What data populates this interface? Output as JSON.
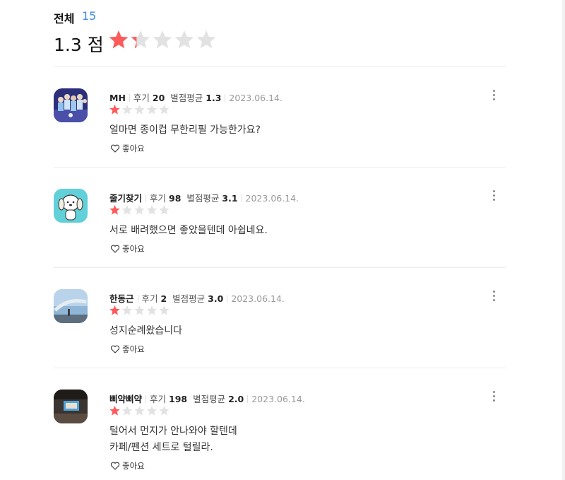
{
  "summary": {
    "all_label": "전체",
    "all_count": "15",
    "score_text": "1.3 점",
    "rating": 1.3,
    "max_rating": 5
  },
  "colors": {
    "star_on": "#ff5a5a",
    "star_off": "#e2e2e2",
    "count_blue": "#3d8be0"
  },
  "reviews": [
    {
      "nickname": "MH",
      "review_label": "후기",
      "review_count": "20",
      "avg_label": "별점평균",
      "avg_value": "1.3",
      "date": "2023.06.14.",
      "rating": 1,
      "text_lines": [
        "얼마면 종이컵 무한리필 가능한가요?"
      ],
      "like_label": "좋아요",
      "avatar": "soccer-team-avatar"
    },
    {
      "nickname": "줄기찾기",
      "review_label": "후기",
      "review_count": "98",
      "avg_label": "별점평균",
      "avg_value": "3.1",
      "date": "2023.06.14.",
      "rating": 1,
      "text_lines": [
        "서로 배려했으면 좋았을텐데 아쉽네요."
      ],
      "like_label": "좋아요",
      "avatar": "puppy-character-avatar"
    },
    {
      "nickname": "한동근",
      "review_label": "후기",
      "review_count": "2",
      "avg_label": "별점평균",
      "avg_value": "3.0",
      "date": "2023.06.14.",
      "rating": 1,
      "text_lines": [
        "성지순례왔습니다"
      ],
      "like_label": "좋아요",
      "avatar": "sky-landscape-avatar"
    },
    {
      "nickname": "삐약삐약",
      "review_label": "후기",
      "review_count": "198",
      "avg_label": "별점평균",
      "avg_value": "2.0",
      "date": "2023.06.14.",
      "rating": 1,
      "text_lines": [
        "털어서 먼지가 안나와야 할텐데",
        "카페/펜션 세트로 털릴라."
      ],
      "like_label": "좋아요",
      "avatar": "room-photo-avatar"
    }
  ]
}
